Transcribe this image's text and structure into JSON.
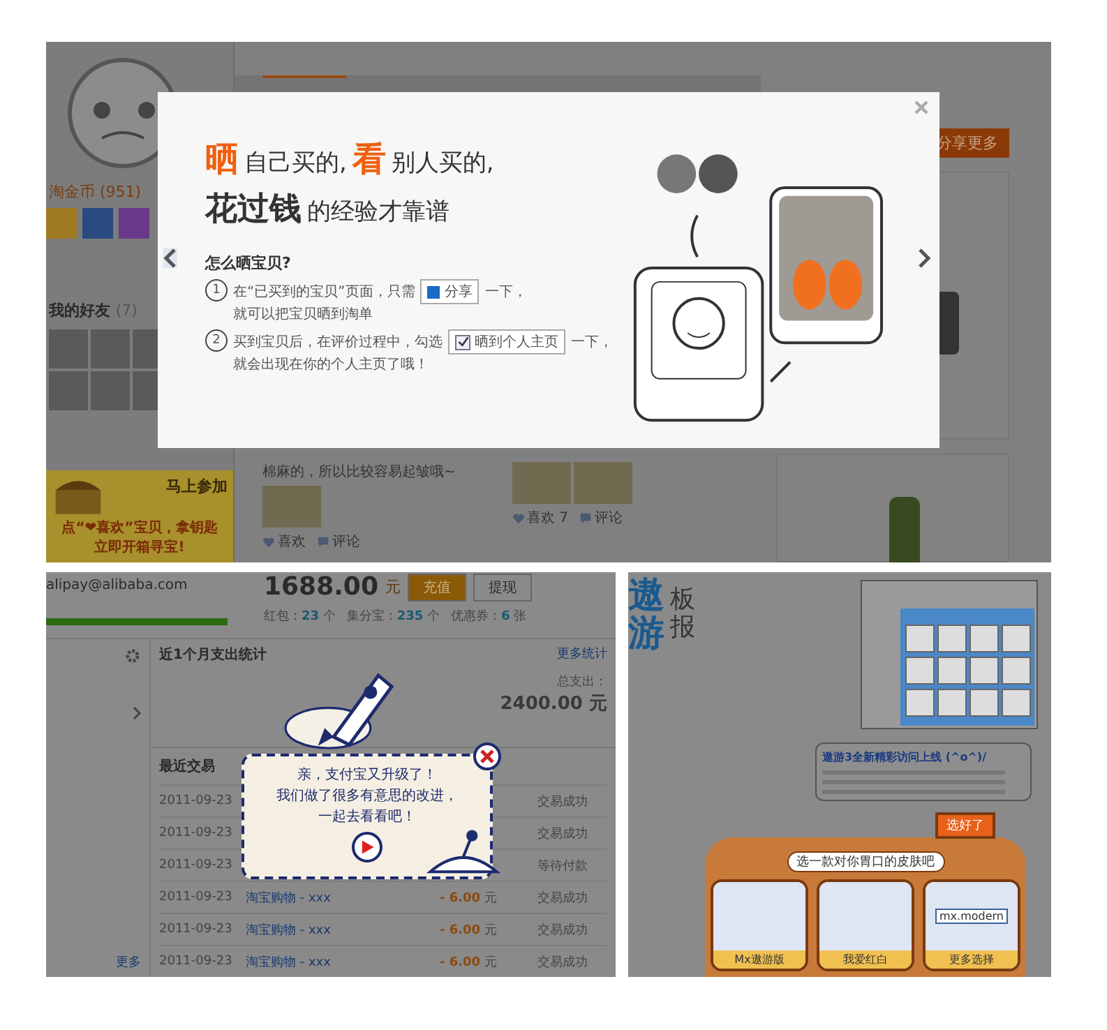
{
  "profile_page": {
    "sidebar": {
      "coins_label": "淘金币",
      "coins_count": "(951)",
      "friends_title": "我的好友",
      "friends_count": "(7)",
      "promo": {
        "action": "马上参加",
        "line_1": "点“❤喜欢”宝贝，拿钥匙",
        "line_2": "立即开箱寻宝!"
      }
    },
    "feed": [
      {
        "caption": "棉麻的，所以比较容易起皱哦~",
        "actions": [
          "喜欢",
          "评论"
        ]
      },
      {
        "actions": [
          "喜欢 7",
          "评论"
        ]
      }
    ],
    "share_more_button": "分享更多",
    "dialog": {
      "headline": [
        [
          {
            "text": "晒",
            "kind": "accent"
          },
          {
            "text": "自己买的,",
            "kind": "plain"
          },
          {
            "text": "看",
            "kind": "accent"
          },
          {
            "text": "别人买的,",
            "kind": "plain"
          }
        ],
        [
          {
            "text": "花过钱",
            "kind": "strong"
          },
          {
            "text": "的经验才靠谱",
            "kind": "plain"
          }
        ]
      ],
      "how_title": "怎么晒宝贝?",
      "steps": [
        {
          "number": "1",
          "before": "在“已买到的宝贝”页面，只需",
          "control": {
            "kind": "button",
            "label": "分享"
          },
          "after": "一下，",
          "line_2": "就可以把宝贝晒到淘单"
        },
        {
          "number": "2",
          "before": "买到宝贝后，在评价过程中，勾选",
          "control": {
            "kind": "checkbox",
            "label": "晒到个人主页",
            "checked": true
          },
          "after": "一下，",
          "line_2": "就会出现在你的个人主页了哦！"
        }
      ]
    }
  },
  "alipay_page": {
    "account": {
      "email": "alipay@alibaba.com",
      "progress": {
        "level": 1
      },
      "balance": "1688.00",
      "currency": "元",
      "buttons": [
        {
          "label": "充值",
          "kind": "primary"
        },
        {
          "label": "提现",
          "kind": "secondary"
        }
      ],
      "stats": [
        {
          "label": "红包：",
          "value": "23",
          "unit": "个"
        },
        {
          "label": "集分宝：",
          "value": "235",
          "unit": "个"
        },
        {
          "label": "优惠券：",
          "value": "6",
          "unit": "张"
        }
      ]
    },
    "spending": {
      "title": "近1个月支出统计",
      "more_link": "更多统计",
      "total_label": "总支出：",
      "total_value": "2400.00",
      "total_unit": "元"
    },
    "transactions": {
      "title": "最近交易",
      "rows": [
        {
          "date": "2011-09-23",
          "status": "交易成功"
        },
        {
          "date": "2011-09-23",
          "status": "交易成功"
        },
        {
          "date": "2011-09-23",
          "status": "等待付款"
        },
        {
          "date": "2011-09-23",
          "name": "淘宝购物 - xxx",
          "amount": "- 6.00",
          "unit": "元",
          "status": "交易成功"
        },
        {
          "date": "2011-09-23",
          "name": "淘宝购物 - xxx",
          "amount": "- 6.00",
          "unit": "元",
          "status": "交易成功"
        },
        {
          "date": "2011-09-23",
          "name": "淘宝购物 - xxx",
          "amount": "- 6.00",
          "unit": "元",
          "status": "交易成功"
        }
      ]
    },
    "sidebar_more": "更多",
    "upgrade_popup": {
      "lines": [
        "亲，支付宝又升级了！",
        "我们做了很多有意思的改进，",
        "一起去看看吧！"
      ]
    }
  },
  "maxthon_page": {
    "title_chars": [
      "遨",
      "游"
    ],
    "subtitle": "板报",
    "bubble_title": "遨游3全新精彩访问上线 (^o^)/",
    "done_button": "选好了",
    "prompt": "选一款对你胃口的皮肤吧",
    "skins": [
      {
        "label": "Mx遨游版"
      },
      {
        "label": "我爱红白"
      },
      {
        "label": "更多选择",
        "preview_text": "mx.modern"
      }
    ]
  }
}
